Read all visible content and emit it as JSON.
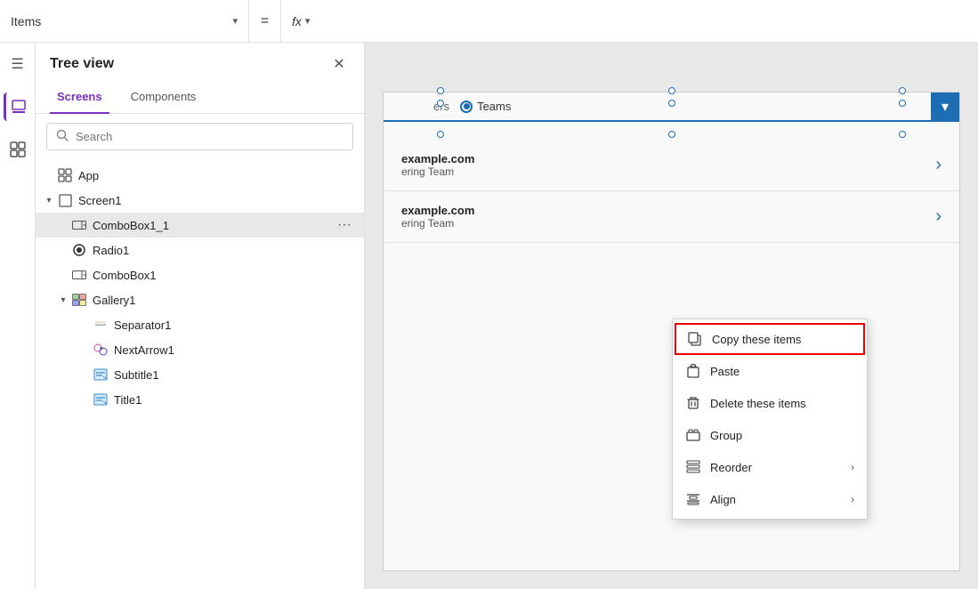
{
  "topbar": {
    "items_label": "Items",
    "items_dropdown_arrow": "▾",
    "equals": "=",
    "fx_label": "fx",
    "fx_arrow": "▾"
  },
  "tree_panel": {
    "title": "Tree view",
    "tabs": [
      {
        "label": "Screens",
        "active": true
      },
      {
        "label": "Components",
        "active": false
      }
    ],
    "search_placeholder": "Search",
    "nodes": [
      {
        "id": "app",
        "label": "App",
        "level": 0,
        "icon": "grid",
        "hasChevron": false,
        "expanded": false
      },
      {
        "id": "screen1",
        "label": "Screen1",
        "level": 0,
        "icon": "screen",
        "hasChevron": true,
        "expanded": true
      },
      {
        "id": "combobox1_1",
        "label": "ComboBox1_1",
        "level": 1,
        "icon": "combobox",
        "hasChevron": false,
        "selected": true
      },
      {
        "id": "radio1",
        "label": "Radio1",
        "level": 1,
        "icon": "radio",
        "hasChevron": false
      },
      {
        "id": "combobox1",
        "label": "ComboBox1",
        "level": 1,
        "icon": "combobox",
        "hasChevron": false
      },
      {
        "id": "gallery1",
        "label": "Gallery1",
        "level": 1,
        "icon": "gallery",
        "hasChevron": true,
        "expanded": true
      },
      {
        "id": "separator1",
        "label": "Separator1",
        "level": 2,
        "icon": "separator",
        "hasChevron": false
      },
      {
        "id": "nextarrow1",
        "label": "NextArrow1",
        "level": 2,
        "icon": "nextarrow",
        "hasChevron": false
      },
      {
        "id": "subtitle1",
        "label": "Subtitle1",
        "level": 2,
        "icon": "text",
        "hasChevron": false
      },
      {
        "id": "title1",
        "label": "Title1",
        "level": 2,
        "icon": "text",
        "hasChevron": false
      }
    ]
  },
  "canvas": {
    "tab_label": "Teams",
    "list_items": [
      {
        "line1": "example.com",
        "line2": "ering Team"
      },
      {
        "line1": "example.com",
        "line2": "ering Team"
      }
    ]
  },
  "context_menu": {
    "items": [
      {
        "id": "copy",
        "label": "Copy these items",
        "icon": "copy",
        "highlighted": true
      },
      {
        "id": "paste",
        "label": "Paste",
        "icon": "paste",
        "highlighted": false
      },
      {
        "id": "delete",
        "label": "Delete these items",
        "icon": "delete",
        "highlighted": false
      },
      {
        "id": "group",
        "label": "Group",
        "icon": "group",
        "highlighted": false
      },
      {
        "id": "reorder",
        "label": "Reorder",
        "icon": "reorder",
        "highlighted": false,
        "hasArrow": true
      },
      {
        "id": "align",
        "label": "Align",
        "icon": "align",
        "highlighted": false,
        "hasArrow": true
      }
    ]
  },
  "icons": {
    "hamburger": "☰",
    "layers": "⊞",
    "components": "⊟",
    "close": "✕",
    "search": "🔍",
    "chevron_right": "›",
    "chevron_down": "▾",
    "more": "..."
  }
}
